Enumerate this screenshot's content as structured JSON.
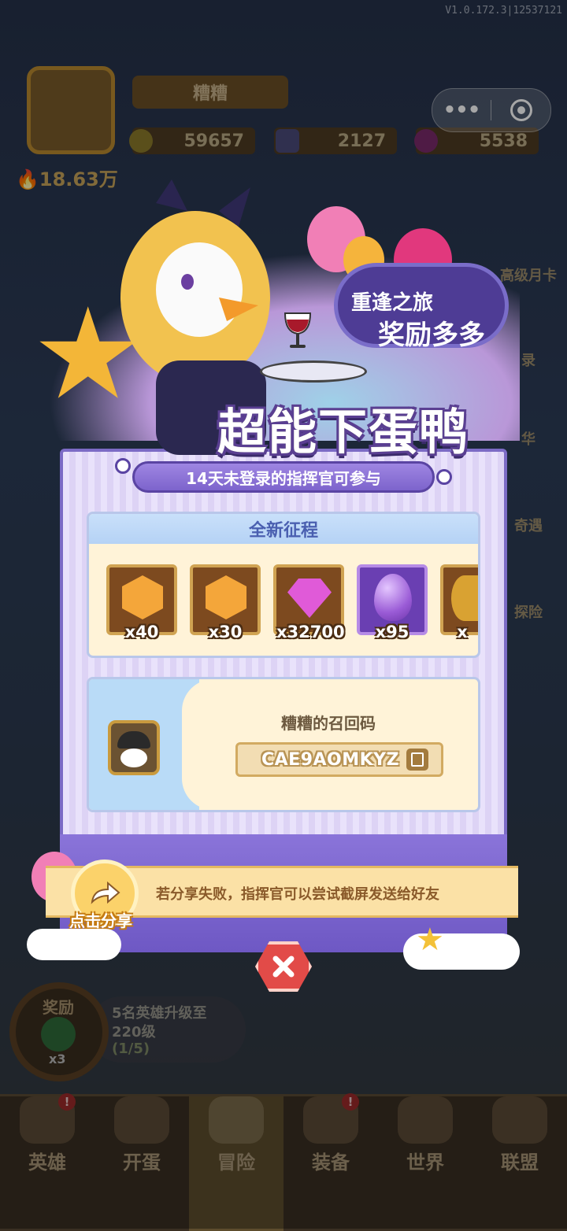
{
  "version": "V1.0.172.3|12537121",
  "player": {
    "name": "糟糟",
    "power": "18.63万"
  },
  "resources": [
    {
      "icon": "gold-coin-icon",
      "value": "59657"
    },
    {
      "icon": "card-ticket-icon",
      "value": "2127"
    },
    {
      "icon": "gem-icon",
      "value": "5538"
    }
  ],
  "capsule": {
    "more": "•••",
    "record": "record-icon"
  },
  "side_right": [
    "高级月卡",
    "录",
    "华",
    "奇遇",
    "探险"
  ],
  "popup": {
    "bubble_line1": "重逢之旅",
    "bubble_line2": "奖励多多",
    "title": "超能下蛋鸭",
    "ribbon": "14天未登录的指挥官可参与",
    "rewards_header": "全新征程",
    "rewards": [
      {
        "icon": "blue-hero-token-icon",
        "qty": "x40"
      },
      {
        "icon": "white-hero-token-icon",
        "qty": "x30"
      },
      {
        "icon": "pink-diamond-icon",
        "qty": "x32700"
      },
      {
        "icon": "purple-egg-icon",
        "qty": "x95"
      },
      {
        "icon": "golden-egg-icon",
        "qty": "x"
      }
    ],
    "code_label": "糟糟的召回码",
    "code_value": "CAE9AOMKYZ",
    "banner_text": "若分享失败，指挥官可以尝试截屏发送给好友",
    "share_label": "点击分享"
  },
  "quest": {
    "reward_label": "奖励",
    "reward_count": "x3",
    "text": "5名英雄升级至220级",
    "progress": "(1/5)"
  },
  "tabs": [
    {
      "label": "英雄",
      "badge": "!"
    },
    {
      "label": "开蛋",
      "badge": ""
    },
    {
      "label": "冒险",
      "badge": ""
    },
    {
      "label": "装备",
      "badge": "!"
    },
    {
      "label": "世界",
      "badge": ""
    },
    {
      "label": "联盟",
      "badge": ""
    }
  ],
  "colors": {
    "accent": "#7d64cc",
    "ribbon": "#9e86e2",
    "close": "#e24b48",
    "banner": "#fbe1a6"
  }
}
